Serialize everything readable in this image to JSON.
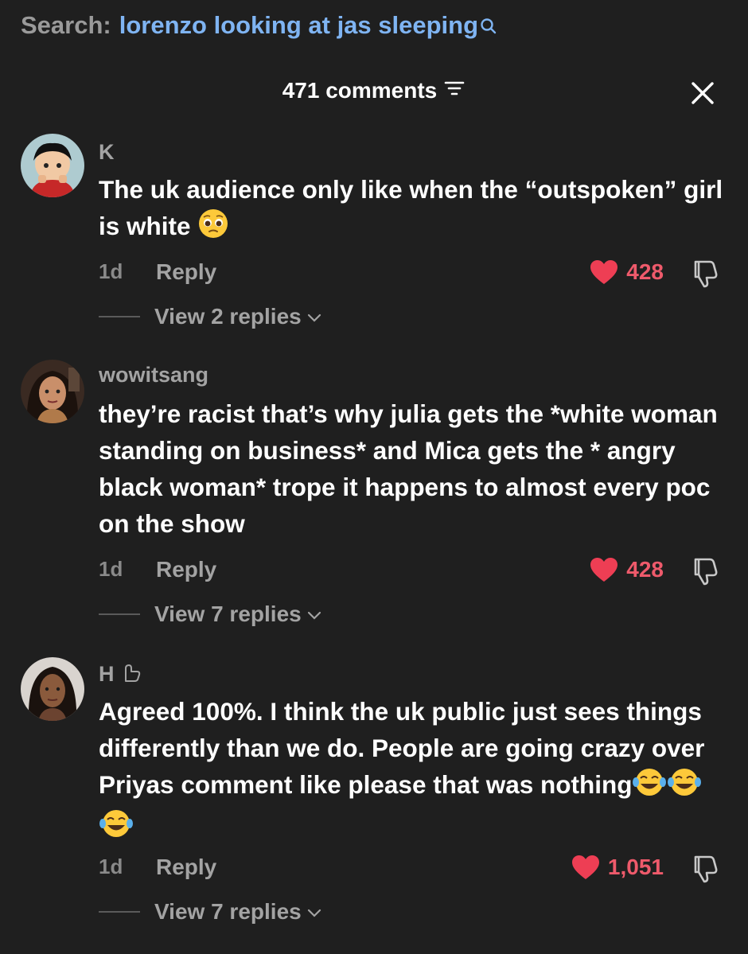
{
  "search": {
    "prefix": "Search:",
    "query": "lorenzo looking at jas sleeping"
  },
  "header": {
    "count_label": "471 comments"
  },
  "comments": [
    {
      "username": "K",
      "text": "The uk audience only like when the “outspoken” girl is white",
      "emoji": [
        "pleading-face"
      ],
      "time": "1d",
      "reply_label": "Reply",
      "likes": "428",
      "view_replies": "View 2 replies"
    },
    {
      "username": "wowitsang",
      "text": "they’re racist that’s why julia gets the *white woman standing on business* and Mica gets the * angry black woman* trope it happens to almost every poc on the show",
      "time": "1d",
      "reply_label": "Reply",
      "likes": "428",
      "view_replies": "View 7 replies"
    },
    {
      "username": "H",
      "text": "Agreed 100%. I think the uk public just sees things differently than we do. People are going crazy over Priyas comment like please that was nothing",
      "emoji": [
        "tears-of-joy",
        "tears-of-joy",
        "tears-of-joy"
      ],
      "time": "1d",
      "reply_label": "Reply",
      "likes": "1,051",
      "view_replies": "View 7 replies"
    }
  ],
  "colors": {
    "background": "#1f1f1f",
    "link": "#7fb4f2",
    "like": "#ee5a6b",
    "muted": "#a3a3a3"
  }
}
